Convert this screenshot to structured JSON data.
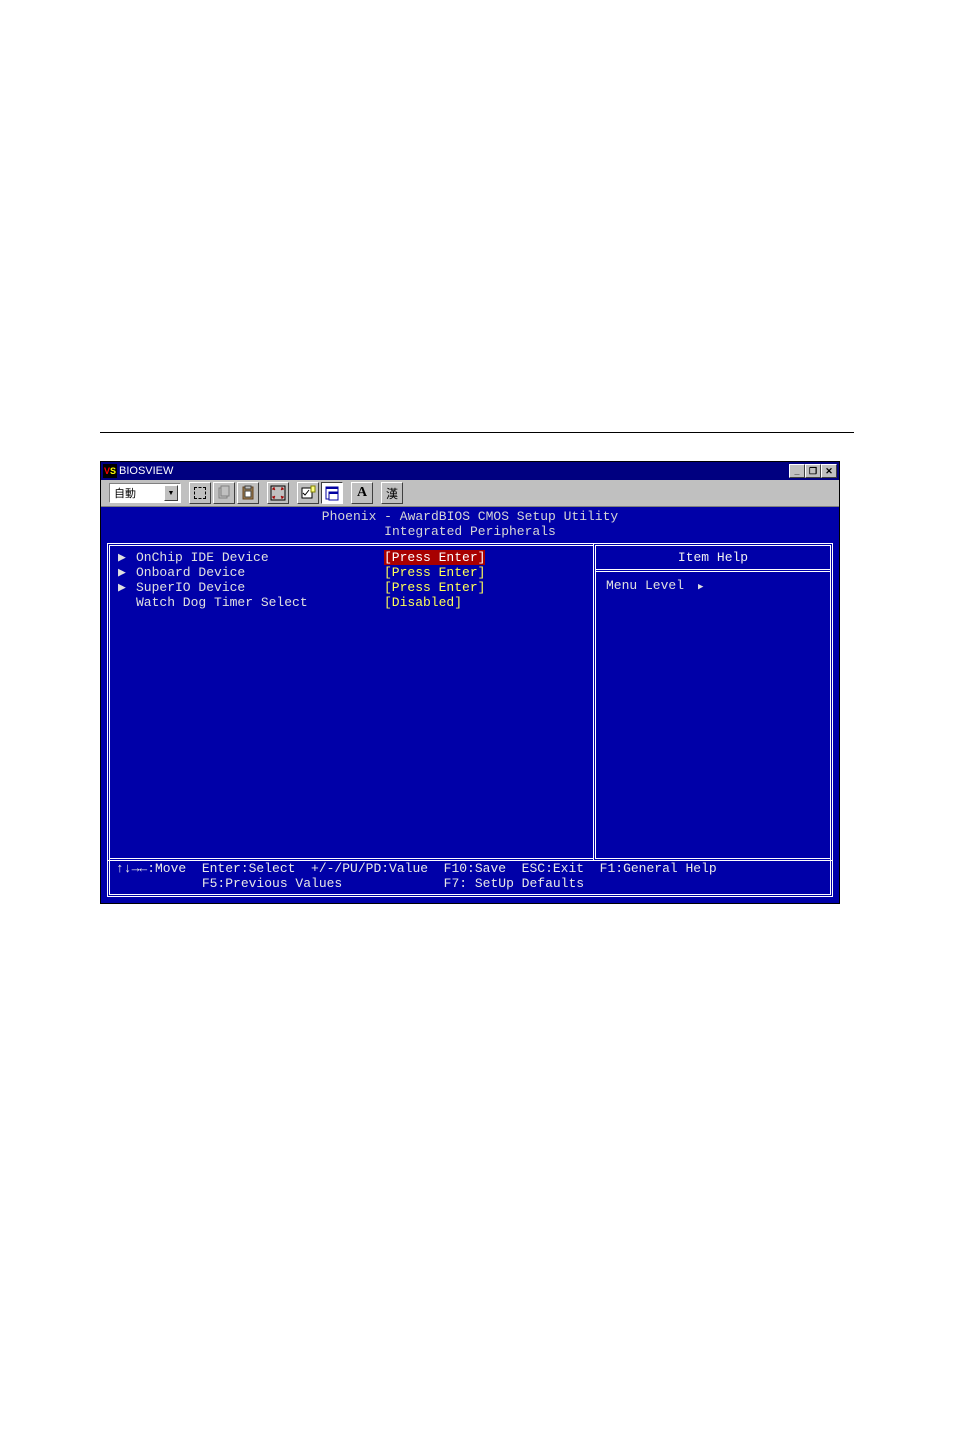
{
  "window": {
    "title": "BIOSVIEW",
    "buttons": {
      "minimize": "_",
      "maximize": "❐",
      "close": "✕"
    }
  },
  "toolbar": {
    "mode_select": "自動",
    "icons": {
      "select": "select-area-icon",
      "copy": "copy-icon",
      "paste": "clipboard-icon",
      "fullscreen": "fullscreen-icon",
      "properties": "properties-icon",
      "windowed": "windowed-icon",
      "font": "font-icon",
      "cjk": "cjk-icon"
    }
  },
  "bios": {
    "title_line1": "Phoenix - AwardBIOS CMOS Setup Utility",
    "title_line2": "Integrated Peripherals",
    "items": [
      {
        "arrow": "▶",
        "label": "OnChip IDE Device",
        "value": "[Press Enter]",
        "selected": true
      },
      {
        "arrow": "▶",
        "label": "Onboard Device",
        "value": "[Press Enter]",
        "selected": false
      },
      {
        "arrow": "▶",
        "label": "SuperIO Device",
        "value": "[Press Enter]",
        "selected": false
      },
      {
        "arrow": "",
        "label": "Watch Dog Timer Select",
        "value": "[Disabled]",
        "selected": false
      }
    ],
    "help_title": "Item Help",
    "menu_level": "Menu Level",
    "footer_line1": "↑↓→←:Move  Enter:Select  +/-/PU/PD:Value  F10:Save  ESC:Exit  F1:General Help",
    "footer_line2": "           F5:Previous Values             F7: SetUp Defaults"
  }
}
